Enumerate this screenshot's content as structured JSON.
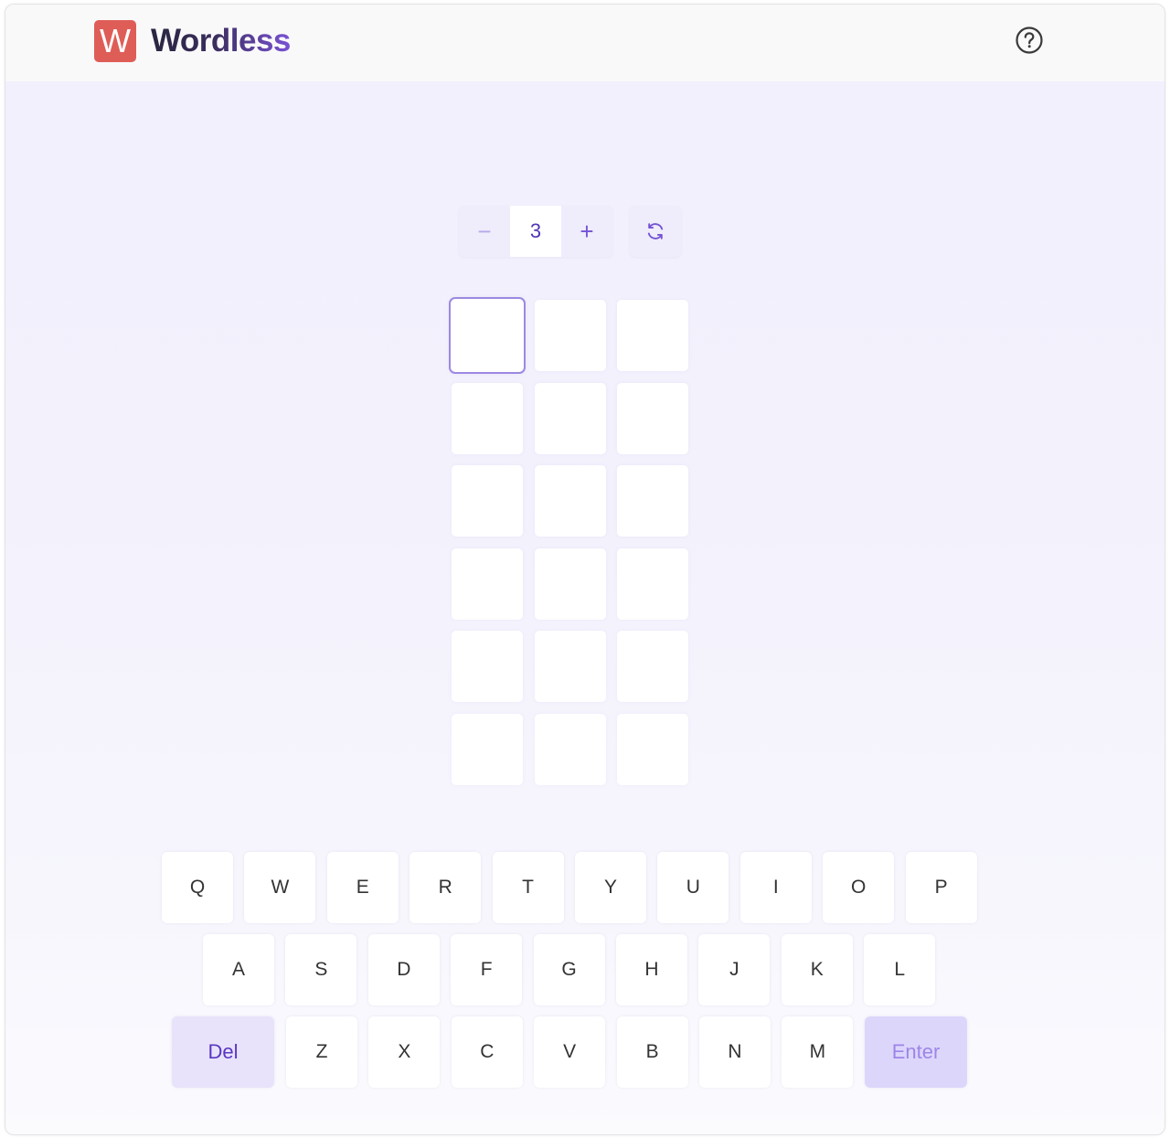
{
  "header": {
    "logo_letter": "W",
    "title": "Wordless",
    "help_icon": "help-circle-icon"
  },
  "controls": {
    "decrement_symbol": "−",
    "word_length": "3",
    "increment_symbol": "+",
    "refresh_icon": "refresh-icon"
  },
  "board": {
    "columns": 3,
    "rows": 6,
    "active_tile": 0
  },
  "keyboard": {
    "row1": [
      "Q",
      "W",
      "E",
      "R",
      "T",
      "Y",
      "U",
      "I",
      "O",
      "P"
    ],
    "row2": [
      "A",
      "S",
      "D",
      "F",
      "G",
      "H",
      "J",
      "K",
      "L"
    ],
    "row3": [
      "Z",
      "X",
      "C",
      "V",
      "B",
      "N",
      "M"
    ],
    "delete_label": "Del",
    "enter_label": "Enter"
  },
  "colors": {
    "logo": "#df5d57",
    "accent": "#7453d4",
    "active_tile_border": "#9c89e2",
    "delete_bg": "#e8e3fa",
    "enter_bg": "#ddd6fb"
  }
}
